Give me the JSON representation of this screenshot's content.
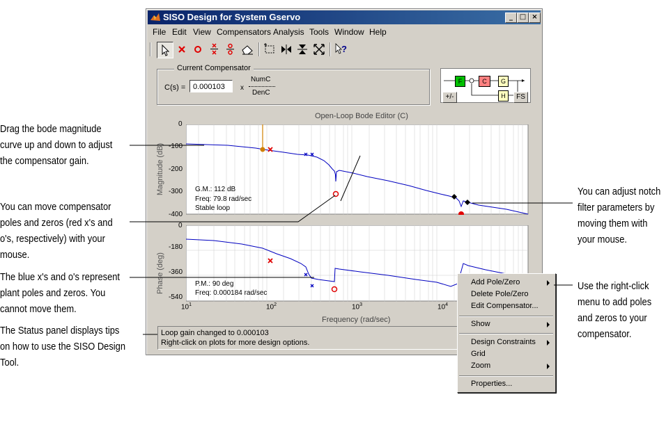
{
  "annotations": {
    "drag_gain": [
      "Drag the bode magnitude",
      "curve up and down to adjust",
      "the compensator gain."
    ],
    "move_poles": [
      "You can move compensator",
      "poles and zeros (red x's and",
      "o's, respectively) with your",
      "mouse."
    ],
    "plant_poles": [
      "The blue x's and o's represent",
      "plant poles and zeros. You",
      "cannot move them."
    ],
    "status_panel": [
      "The Status panel displays tips",
      "on how to use the SISO Design",
      "Tool."
    ],
    "notch": [
      "You can adjust notch",
      "filter parameters by",
      "moving them with",
      "your mouse."
    ],
    "right_click": [
      "Use the right-click",
      "menu to add poles",
      "and zeros to your",
      "compensator."
    ]
  },
  "window": {
    "title": "SISO Design for System Gservo",
    "minimize": "_",
    "maximize": "□",
    "close": "×"
  },
  "menubar": [
    "File",
    "Edit",
    "View",
    "Compensators",
    "Analysis",
    "Tools",
    "Window",
    "Help"
  ],
  "toolbar_icons": [
    "select-arrow-icon",
    "add-real-pole-icon",
    "add-real-zero-icon",
    "add-complex-pole-icon",
    "add-complex-zero-icon",
    "eraser-icon",
    "zoom-box-icon",
    "zoom-x-icon",
    "zoom-y-icon",
    "fit-icon",
    "whats-this-icon"
  ],
  "compensator": {
    "group_title": "Current Compensator",
    "c_label": "C(s) =",
    "gain_value": "0.000103",
    "times": "x",
    "numerator": "NumC",
    "denominator": "DenC"
  },
  "block_diagram": {
    "f": "F",
    "c": "C",
    "g": "G",
    "h": "H",
    "sign_button": "+/-",
    "fs_button": "FS"
  },
  "bode": {
    "title": "Open-Loop Bode Editor (C)",
    "mag_ylabel": "Magnitude (dB)",
    "phase_ylabel": "Phase (deg)",
    "xlabel": "Frequency (rad/sec)",
    "mag_ticks": [
      "0",
      "-100",
      "-200",
      "-300",
      "-400"
    ],
    "phase_ticks": [
      "0",
      "-180",
      "-360",
      "-540"
    ],
    "x_ticks": [
      "10",
      "10",
      "10",
      "10"
    ],
    "x_exps": [
      "1",
      "2",
      "3",
      "4"
    ],
    "gm": "G.M.: 112 dB",
    "gm_freq": "Freq: 79.8 rad/sec",
    "stable": "Stable loop",
    "pm": "P.M.: 90 deg",
    "pm_freq": "Freq: 0.000184 rad/sec"
  },
  "status": {
    "line1": "Loop gain changed to 0.000103",
    "line2": "Right-click on plots for more design options."
  },
  "context_menu": {
    "add_pole_zero": "Add Pole/Zero",
    "delete_pole_zero": "Delete Pole/Zero",
    "edit_compensator": "Edit Compensator...",
    "show": "Show",
    "design_constraints": "Design Constraints",
    "grid": "Grid",
    "zoom": "Zoom",
    "properties": "Properties..."
  },
  "colors": {
    "title_bar": "#0a246a",
    "plant_curve": "#0000c0",
    "compensator_marker": "#e00000",
    "gain_marker": "#d08000"
  }
}
